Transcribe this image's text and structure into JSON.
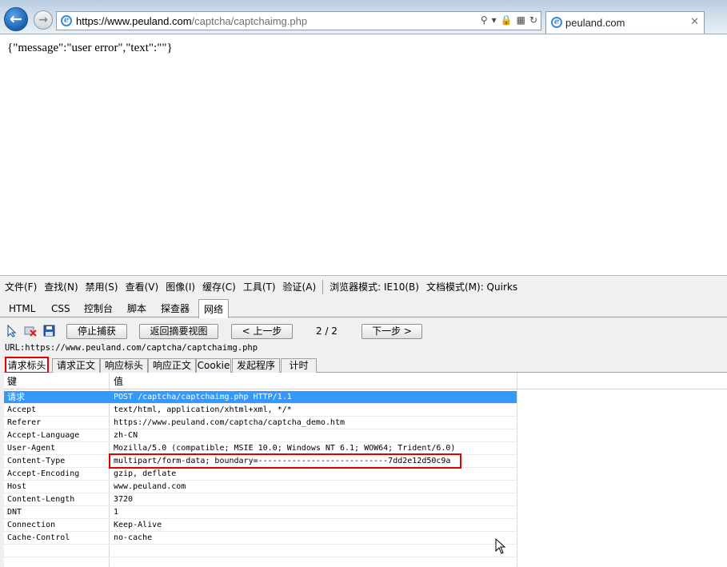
{
  "browser": {
    "address": {
      "scheme": "https://",
      "domain": "www.peuland.com",
      "path": "/captcha/captchaimg.php"
    },
    "tab_title": "peuland.com"
  },
  "page": {
    "body_text": "{\"message\":\"user error\",\"text\":\"\"}"
  },
  "devtools": {
    "menu": [
      "文件(F)",
      "查找(N)",
      "禁用(S)",
      "查看(V)",
      "图像(I)",
      "缓存(C)",
      "工具(T)",
      "验证(A)"
    ],
    "browser_mode": "浏览器模式: IE10(B)",
    "doc_mode": "文档模式(M): Quirks",
    "tabs": [
      "HTML",
      "CSS",
      "控制台",
      "脚本",
      "探查器",
      "网络"
    ],
    "active_tab": "网络",
    "toolbar": {
      "stop_capture": "停止捕获",
      "back_to_summary": "返回摘要视图",
      "prev": "< 上一步",
      "pager": "2 / 2",
      "next": "下一步 >"
    },
    "url_line": "URL:https://www.peuland.com/captcha/captchaimg.php",
    "subtabs": [
      "请求标头",
      "请求正文",
      "响应标头",
      "响应正文",
      "Cookie",
      "发起程序",
      "计时"
    ],
    "active_subtab": "请求标头",
    "headers": {
      "col_key": "键",
      "col_value": "值",
      "rows": [
        {
          "key": "请求",
          "value": "POST /captcha/captchaimg.php HTTP/1.1"
        },
        {
          "key": "Accept",
          "value": "text/html, application/xhtml+xml, */*"
        },
        {
          "key": "Referer",
          "value": "https://www.peuland.com/captcha/captcha_demo.htm"
        },
        {
          "key": "Accept-Language",
          "value": "zh-CN"
        },
        {
          "key": "User-Agent",
          "value": "Mozilla/5.0 (compatible; MSIE 10.0; Windows NT 6.1; WOW64; Trident/6.0)"
        },
        {
          "key": "Content-Type",
          "value": "multipart/form-data; boundary=---------------------------7dd2e12d50c9a"
        },
        {
          "key": "Accept-Encoding",
          "value": "gzip, deflate"
        },
        {
          "key": "Host",
          "value": "www.peuland.com"
        },
        {
          "key": "Content-Length",
          "value": "3720"
        },
        {
          "key": "DNT",
          "value": "1"
        },
        {
          "key": "Connection",
          "value": "Keep-Alive"
        },
        {
          "key": "Cache-Control",
          "value": "no-cache"
        }
      ]
    }
  },
  "colors": {
    "selection": "#3399ff",
    "highlight": "#e00000"
  }
}
